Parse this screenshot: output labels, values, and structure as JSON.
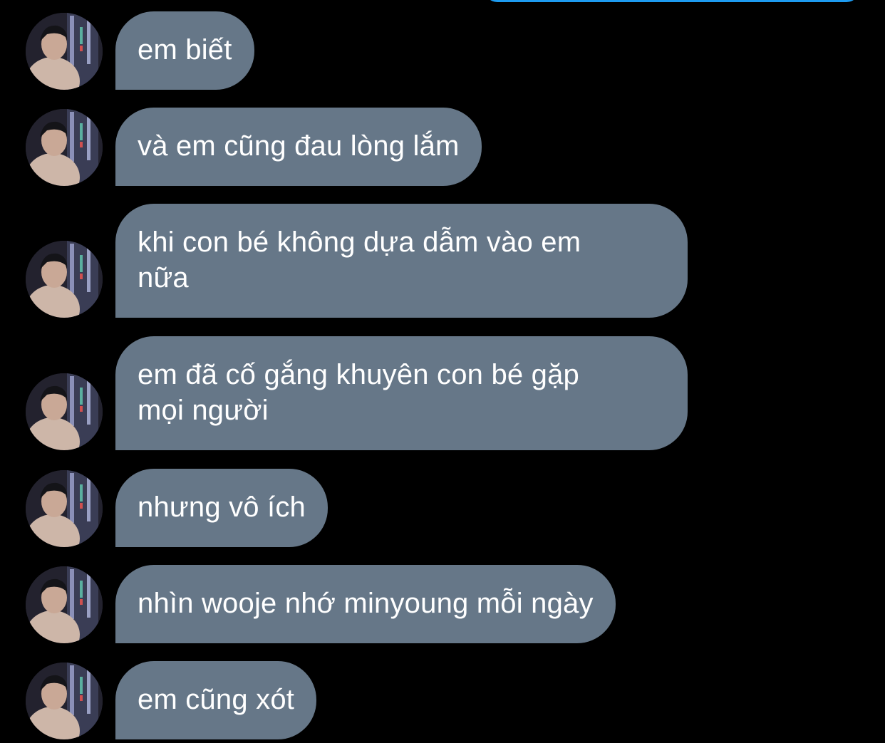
{
  "colors": {
    "background": "#000000",
    "bubble": "#667788",
    "bubble_text": "#ffffff",
    "own_bubble": "#1d9bf0"
  },
  "messages": [
    {
      "text": "em biết",
      "avatar": "avatar"
    },
    {
      "text": "và em cũng đau lòng lắm",
      "avatar": "avatar"
    },
    {
      "text": "khi con bé không dựa dẫm vào em\nnữa",
      "avatar": "avatar"
    },
    {
      "text": "em đã cố gắng khuyên con bé gặp\nmọi người",
      "avatar": "avatar"
    },
    {
      "text": "nhưng vô ích",
      "avatar": "avatar"
    },
    {
      "text": "nhìn wooje nhớ minyoung mỗi ngày",
      "avatar": "avatar"
    },
    {
      "text": "em cũng xót",
      "avatar": "avatar"
    }
  ]
}
